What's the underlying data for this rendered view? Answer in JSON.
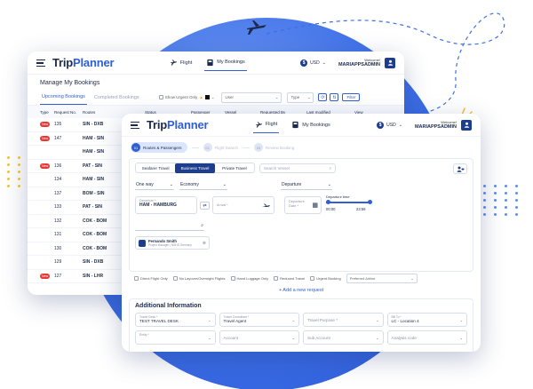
{
  "brand": {
    "part1": "Trip",
    "part2": "Planner"
  },
  "nav": {
    "flight": "Flight",
    "bookings": "My Bookings"
  },
  "currency": "USD",
  "user": {
    "welcome": "Welcome!",
    "name": "MARIAPPSADMIN"
  },
  "back": {
    "title": "Manage My Bookings",
    "tabs": [
      "Upcoming Bookings",
      "Completed Bookings"
    ],
    "urgent_label": "Show Urgent Only",
    "user_select": "User",
    "type_select": "Type",
    "filter_label": "Filter",
    "columns": [
      "Type",
      "Request No.",
      "Routes",
      "Status",
      "Passenger",
      "Vessel",
      "Requested By",
      "Last modified",
      "View"
    ],
    "rows": [
      {
        "tag": "New",
        "no": "135",
        "route": "SIN - DXB"
      },
      {
        "tag": "New",
        "no": "147",
        "route": "HAM - SIN"
      },
      {
        "tag": "",
        "no": "",
        "route": "HAM - SIN"
      },
      {
        "tag": "New",
        "no": "136",
        "route": "PAT - SIN"
      },
      {
        "tag": "",
        "no": "134",
        "route": "HAM - SIN"
      },
      {
        "tag": "",
        "no": "137",
        "route": "BOM - SIN"
      },
      {
        "tag": "",
        "no": "133",
        "route": "PAT - SIN"
      },
      {
        "tag": "",
        "no": "132",
        "route": "COK - BOM"
      },
      {
        "tag": "",
        "no": "131",
        "route": "COK - BOM"
      },
      {
        "tag": "",
        "no": "130",
        "route": "COK - BOM"
      },
      {
        "tag": "",
        "no": "129",
        "route": "SIN - DXB"
      },
      {
        "tag": "New",
        "no": "127",
        "route": "SIN - LHR"
      }
    ]
  },
  "front": {
    "steps": [
      {
        "num": "01",
        "label": "Routes & Passengers"
      },
      {
        "num": "02",
        "label": "Flight Search"
      },
      {
        "num": "03",
        "label": "Review Booking"
      }
    ],
    "types": [
      "Seafarer Travel",
      "Business Travel",
      "Private Travel"
    ],
    "search_placeholder": "Search Vessel",
    "trip": "One way",
    "cabin": "Economy",
    "departure_label": "Departure",
    "origin_label": "Departure *",
    "origin_value": "HAM - HAMBURG",
    "arrival_label": "Arrival *",
    "date_label": "Departure Date *",
    "time_label": "Departure time",
    "time_from": "00:00",
    "time_to": "23:59",
    "passenger": {
      "name": "Fernando Smith",
      "role": "Project Manager | NSHS Germany"
    },
    "filters": [
      "Direct Flight Only",
      "No Layover/Overnight Flights",
      "Hand Luggage Only",
      "Reduced Travel",
      "Urgent Booking"
    ],
    "airline_placeholder": "Preferred Airline",
    "add_request": "Add a new request",
    "additional_title": "Additional Information",
    "info_fields": [
      {
        "label": "Travel Desk *",
        "value": "TEST TRAVEL DESK"
      },
      {
        "label": "Travel Consultant *",
        "value": "Travel Agent"
      },
      {
        "label": "",
        "value": "Travel Purpose *"
      },
      {
        "label": "Bill To *",
        "value": "LC - Location 4"
      },
      {
        "label": "Entity *",
        "value": ""
      },
      {
        "label": "",
        "value": "Account"
      },
      {
        "label": "",
        "value": "Sub Account"
      },
      {
        "label": "",
        "value": "Analysis code"
      }
    ]
  },
  "colors": {
    "primary": "#1d3d8f",
    "accent": "#2f5fd3",
    "blob": "#3d6fe8",
    "urgent": "#e53935"
  }
}
